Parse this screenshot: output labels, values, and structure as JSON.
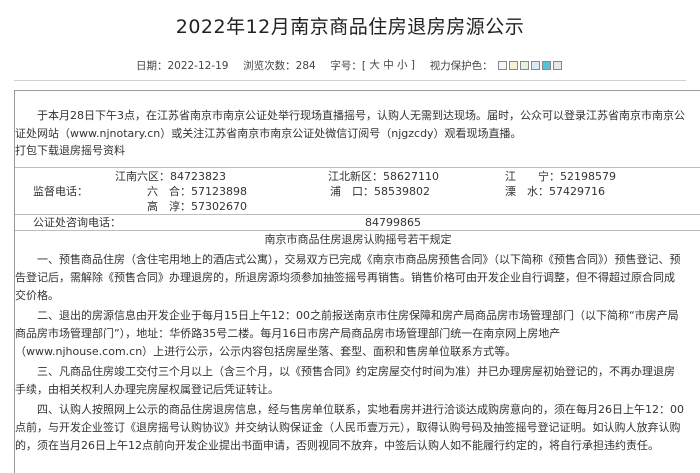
{
  "title": "2022年12月南京商品住房退房房源公示",
  "meta": {
    "date": "日期：2022-12-19",
    "views": "浏览次数：284",
    "fontsize_label": "字号：[",
    "font_large": "大",
    "font_medium": "中",
    "font_small": "小",
    "fontsize_end": "]",
    "eye_protect": "视力保护色：",
    "swatches": [
      "#f5f5f5",
      "#f9f0d9",
      "#e3f1e4",
      "#dbe7f4",
      "#5bc0de",
      "#e8e8e8"
    ]
  },
  "intro": "于本月28日下午3点，在江苏省南京市南京公证处举行现场直播摇号，认购人无需到达现场。届时，公众可以登录江苏省南京市南京公证处网站（www.njnotary.cn）或关注江苏省南京市南京公证处微信订阅号（njgzcdy）观看现场直播。",
  "download_link": "打包下载退房摇号资料",
  "phones": {
    "label": "监督电话：",
    "row1": [
      "江南六区：84723823",
      "江北新区：58627110",
      "江　　宁：52198579"
    ],
    "row2": [
      "六　合：57123898",
      "浦　口：58539802",
      "溧　水：57429716"
    ],
    "row3": [
      "高　淳：57302670"
    ]
  },
  "notary": {
    "label": "公证处咨询电话：",
    "number": "84799865"
  },
  "rules_title": "南京市商品住房退房认购摇号若干规定",
  "rules": [
    "一、预售商品住房（含住宅用地上的酒店式公寓），交易双方已完成《南京市商品房预售合同》（以下简称《预售合同》）预售登记、预告登记后，需解除《预售合同》办理退房的，所退房源均须参加抽签摇号再销售。销售价格可由开发企业自行调整，但不得超过原合同成交价格。",
    "二、退出的房源信息由开发企业于每月15日上午12：00之前报送南京市住房保障和房产局商品房市场管理部门（以下简称“市房产局商品房市场管理部门”），地址：华侨路35号二楼。每月16日市房产局商品房市场管理部门统一在南京网上房地产（www.njhouse.com.cn）上进行公示，公示内容包括房屋坐落、套型、面积和售房单位联系方式等。",
    "三、凡商品住房竣工交付三个月以上（含三个月，以《预售合同》约定房屋交付时间为准）并已办理房屋初始登记的，不再办理退房手续，由相关权利人办理完房屋权属登记后凭证转让。",
    "四、认购人按照网上公示的商品住房退房信息，经与售房单位联系，实地看房并进行洽谈达成购房意向的，须在每月26日上午12：00点前，与开发企业签订《退房摇号认购协议》并交纳认购保证金（人民币壹万元），取得认购号码及抽签摇号登记证明。如认购人放弃认购的，须在当月26日上午12点前向开发企业提出书面申请，否则视同不放弃，中签后认购人如不能履行约定的，将自行承担违约责任。"
  ]
}
